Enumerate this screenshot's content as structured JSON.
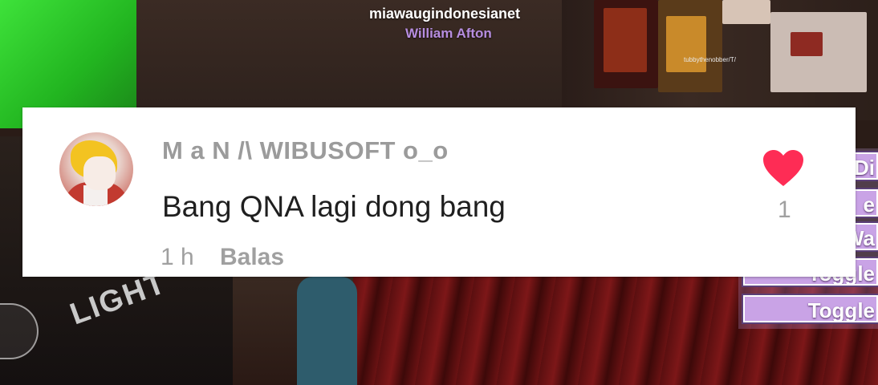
{
  "background": {
    "streamer_name": "miawaugindonesianet",
    "streamer_subtitle": "William Afton",
    "small_tag": "tubbythenobber/T/",
    "light_label": "LIGHT",
    "menu_buttons": [
      "Di",
      "e",
      "Wa",
      "Toggle",
      "Toggle"
    ]
  },
  "comment": {
    "username": "M a N /\\ WIBUSOFT o_o",
    "text": "Bang QNA lagi dong bang",
    "time": "1 h",
    "reply_label": "Balas",
    "like_count": "1",
    "avatar_icon": "anime-avatar",
    "heart_icon": "heart-filled",
    "heart_color": "#fe2c55"
  }
}
